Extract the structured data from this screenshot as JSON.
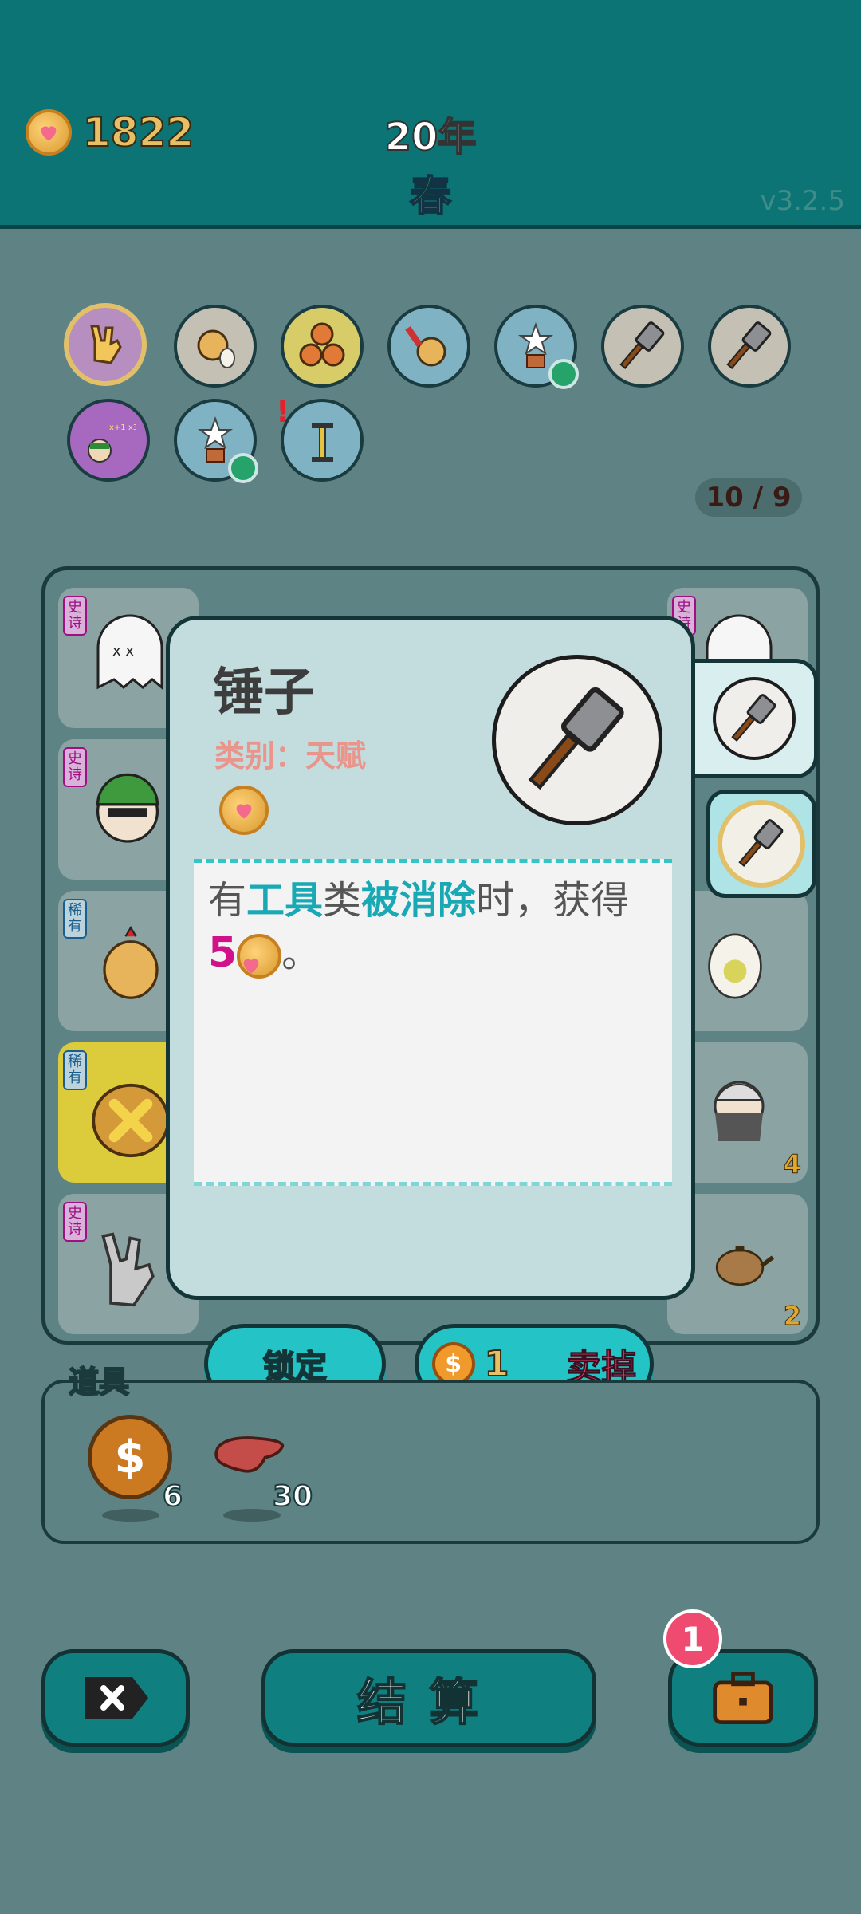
{
  "header": {
    "coins": "1822",
    "year": "20年",
    "season": "春",
    "version": "v3.2.5"
  },
  "talents": {
    "count": "10 / 9"
  },
  "board": {
    "tags": {
      "epic": "史诗",
      "rare": "稀有"
    },
    "counts": [
      "4",
      "2"
    ]
  },
  "popup": {
    "title": "锤子",
    "category": "类别：天赋",
    "desc": {
      "p1": "有",
      "tool": "工具",
      "p2": "类",
      "removed": "被消除",
      "p3": "时，获得",
      "amount": "5",
      "end": "。"
    }
  },
  "actions": {
    "lock": "锁定",
    "price": "1",
    "sell": "卖掉"
  },
  "items": {
    "title": "道具",
    "coin_count": "6",
    "liver_count": "30"
  },
  "bottom": {
    "settle": "结算",
    "badge": "1"
  },
  "colors": {
    "teal": "#0c7474",
    "accent": "#23c3c6",
    "rare_tag": "#1a5e8e",
    "epic_tag": "#9e0f84"
  }
}
